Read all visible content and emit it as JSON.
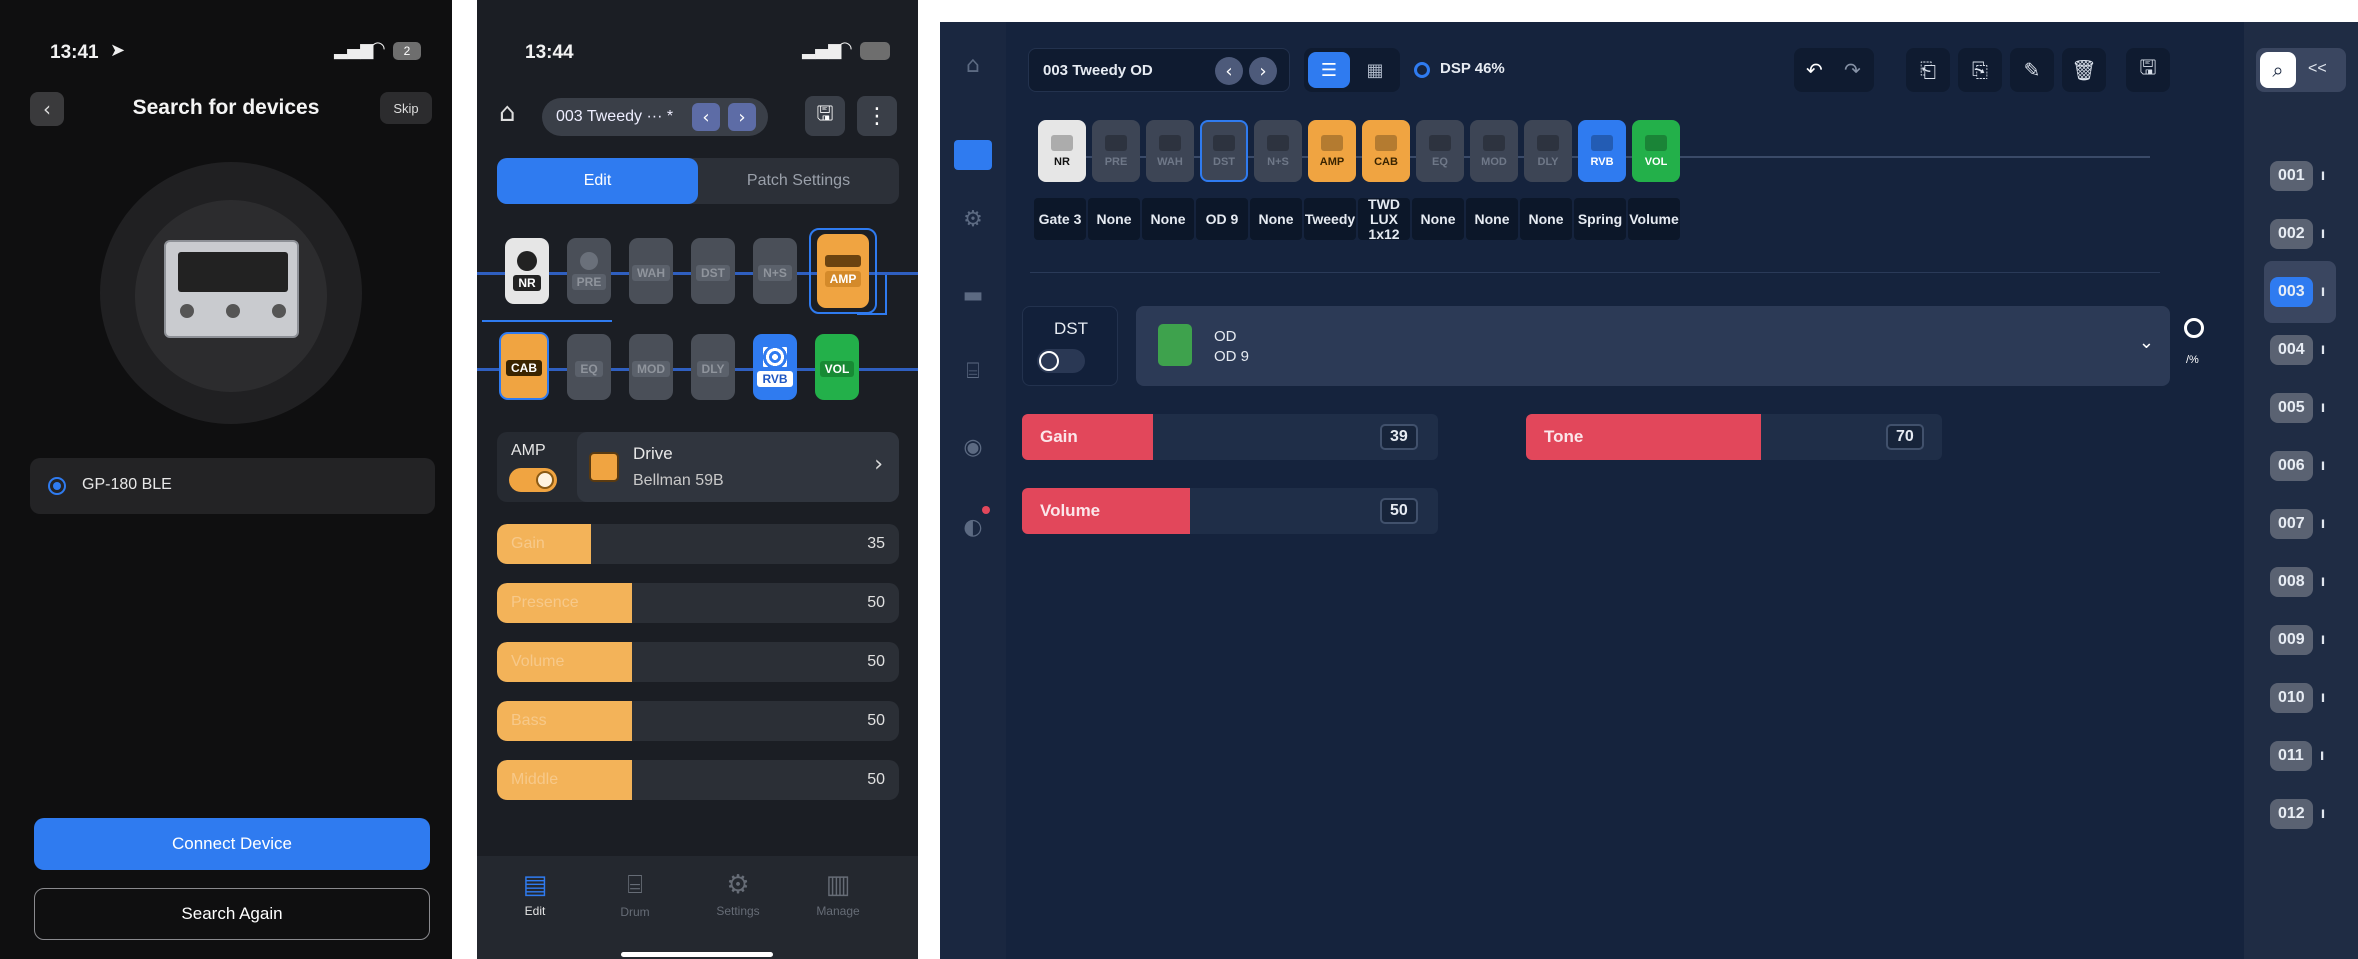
{
  "phone1": {
    "time": "13:41",
    "badge": "2",
    "title": "Search for devices",
    "skip": "Skip",
    "device": "GP-180 BLE",
    "connect": "Connect Device",
    "search_again": "Search Again"
  },
  "phone2": {
    "time": "13:44",
    "patch": "003 Tweedy ··· *",
    "tabs": [
      "Edit",
      "Patch Settings"
    ],
    "row1": [
      "NR",
      "PRE",
      "WAH",
      "DST",
      "N+S",
      "AMP"
    ],
    "row2": [
      "CAB",
      "EQ",
      "MOD",
      "DLY",
      "RVB",
      "VOL"
    ],
    "amp_label": "AMP",
    "drive_title": "Drive",
    "drive_model": "Bellman 59B",
    "params": [
      {
        "name": "Gain",
        "value": 35
      },
      {
        "name": "Presence",
        "value": 50
      },
      {
        "name": "Volume",
        "value": 50
      },
      {
        "name": "Bass",
        "value": 50
      },
      {
        "name": "Middle",
        "value": 50
      }
    ],
    "nav": [
      "Edit",
      "Drum",
      "Settings",
      "Manage"
    ]
  },
  "tablet": {
    "patch": "003 Tweedy OD",
    "dsp": "DSP 46%",
    "chain_icons": [
      "NR",
      "PRE",
      "WAH",
      "DST",
      "N+S",
      "AMP",
      "CAB",
      "EQ",
      "MOD",
      "DLY",
      "RVB",
      "VOL"
    ],
    "chain_labels": [
      "Gate 3",
      "None",
      "None",
      "OD 9",
      "None",
      "Tweedy",
      "TWD LUX 1x12",
      "None",
      "None",
      "None",
      "Spring",
      "Volume"
    ],
    "module": "DST",
    "effect_name": "OD",
    "effect_model": "OD 9",
    "pct": "/%",
    "params": [
      {
        "name": "Gain",
        "value": 39
      },
      {
        "name": "Tone",
        "value": 70
      },
      {
        "name": "Volume",
        "value": 50
      }
    ],
    "patches": [
      "001",
      "002",
      "003",
      "004",
      "005",
      "006",
      "007",
      "008",
      "009",
      "010",
      "011",
      "012"
    ],
    "collapse": "<<"
  },
  "colors": {
    "accent_blue": "#2f7bf0",
    "amp_orange": "#f0a441",
    "gain_red": "#e2475b",
    "vol_green": "#23b04a"
  }
}
